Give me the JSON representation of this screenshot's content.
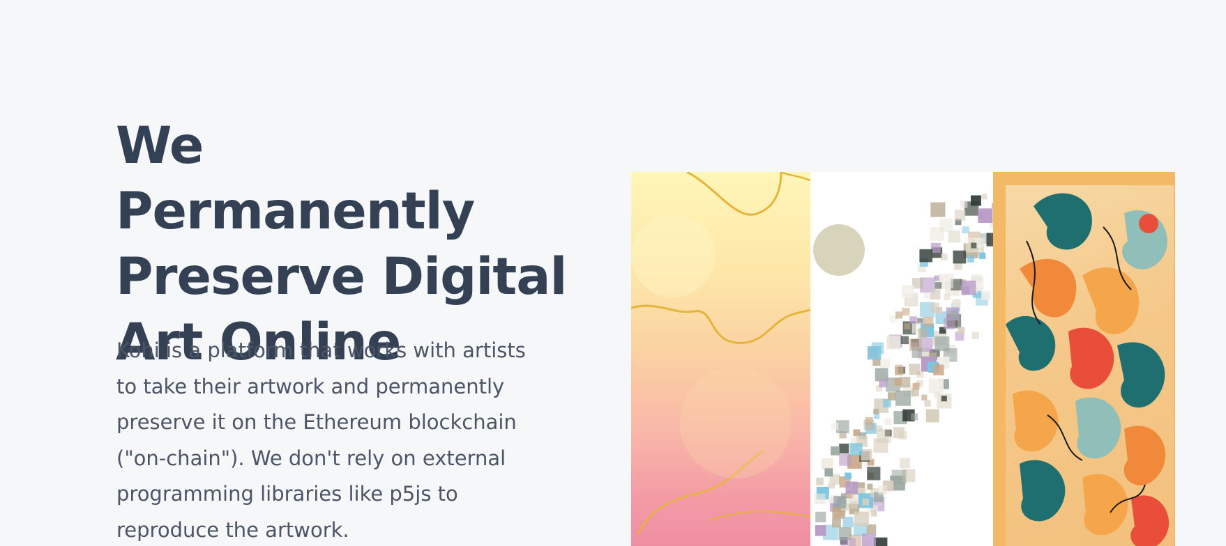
{
  "hero": {
    "title_lines": [
      "We Permanently",
      "Preserve Digital",
      "Art Online"
    ],
    "description_lines": [
      "Kohi is a platform that works with artists",
      "to take their artwork and permanently",
      "preserve it on the Ethereum blockchain",
      "(\"on-chain\"). We don't rely on external",
      "programming libraries like p5js to",
      "reproduce the artwork."
    ]
  },
  "gallery": {
    "artworks": [
      {
        "palette": [
          "#fff6b8",
          "#fbd2a3",
          "#f39aa6",
          "#e9b94a"
        ]
      },
      {
        "palette": [
          "#ffffff",
          "#d8d4c0",
          "#2f3a33",
          "#b89ac8",
          "#7fc6e0"
        ]
      },
      {
        "palette": [
          "#f3b966",
          "#1f6f70",
          "#f08a3a",
          "#e94e3a",
          "#8fbfb8"
        ]
      }
    ]
  },
  "colors": {
    "background": "#f6f7f9",
    "title": "#344054",
    "body_text": "#4b5565"
  }
}
